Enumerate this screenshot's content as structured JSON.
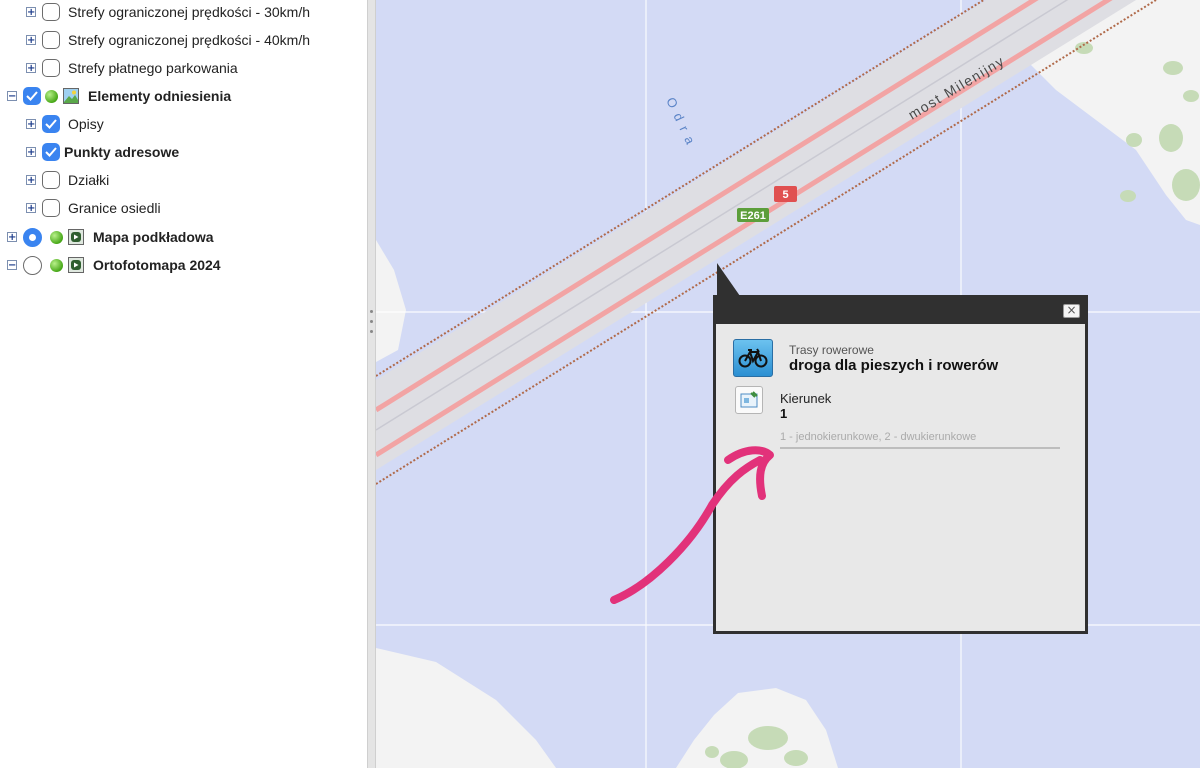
{
  "layer_tree": {
    "items": [
      {
        "label": "Strefy ograniczonej prędkości - 30km/h",
        "expander": "+",
        "checked": false,
        "bold": false
      },
      {
        "label": "Strefy ograniczonej prędkości - 40km/h",
        "expander": "+",
        "checked": false,
        "bold": false
      },
      {
        "label": "Strefy płatnego parkowania",
        "expander": "+",
        "checked": false,
        "bold": false
      },
      {
        "label": "Elementy odniesienia",
        "expander": "−",
        "checked": true,
        "bold": true
      },
      {
        "label": "Opisy",
        "expander": "+",
        "checked": true,
        "bold": false
      },
      {
        "label": "Punkty adresowe",
        "expander": "+",
        "checked": true,
        "bold": true
      },
      {
        "label": "Działki",
        "expander": "+",
        "checked": false,
        "bold": false
      },
      {
        "label": "Granice osiedli",
        "expander": "+",
        "checked": false,
        "bold": false
      },
      {
        "label": "Mapa podkładowa",
        "expander": "+",
        "selected": true,
        "bold": true
      },
      {
        "label": "Ortofotomapa 2024",
        "expander": "−",
        "selected": false,
        "bold": true
      }
    ]
  },
  "map": {
    "river_label": "Odra",
    "bridge_label": "most Milenijny",
    "shields": {
      "e_road": "E261",
      "national_road": "5"
    },
    "colors": {
      "water": "#d3daf5",
      "land": "#f3f3f3",
      "green": "#c6dbb7",
      "road": "#dedee3",
      "road_line": "#f2a4a4",
      "rail": "#b06a4a"
    }
  },
  "popup": {
    "layer_name": "Trasy rowerowe",
    "feature_name": "droga dla pieszych i rowerów",
    "attribute_name": "Kierunek",
    "attribute_value": "1",
    "attribute_hint": "1 - jednokierunkowe, 2 - dwukierunkowe",
    "close_label": "×",
    "icons": {
      "feature": "bicycle-icon",
      "attribute": "attribute-icon",
      "close": "close-icon"
    }
  },
  "annotation": {
    "color": "#e2327a",
    "kind": "hand-drawn arrow"
  }
}
